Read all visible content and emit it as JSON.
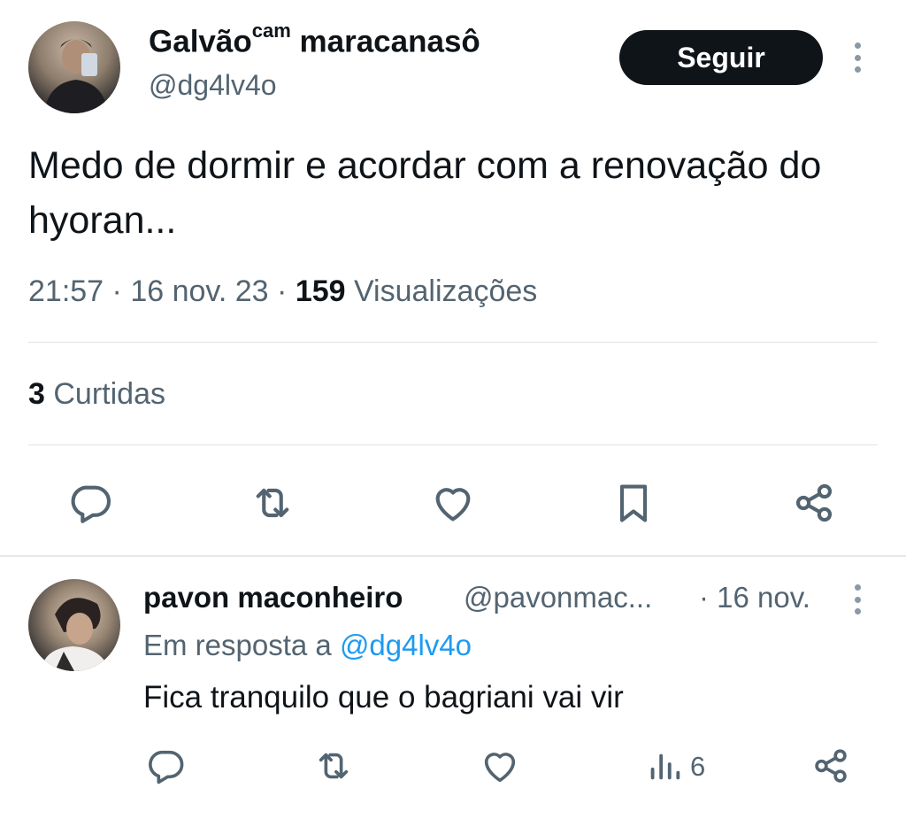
{
  "tweet": {
    "display_name": "Galvão",
    "display_name_sup": "cam",
    "display_name_rest": " maracanasô",
    "handle": "@dg4lv4o",
    "follow_label": "Seguir",
    "text": "Medo de dormir e acordar com a renovação do hyoran...",
    "time": "21:57",
    "sep1": " · ",
    "date": "16 nov. 23",
    "sep2": " · ",
    "views_count": "159",
    "views_label": " Visualizações",
    "likes_count": "3",
    "likes_label": " Curtidas"
  },
  "reply": {
    "display_name": "pavon maconheiro",
    "handle": "@pavonmac...",
    "date": "· 16 nov.",
    "replying_prefix": "Em resposta a ",
    "replying_to": "@dg4lv4o",
    "text": "Fica tranquilo que o bagriani vai vir",
    "views_count": "6"
  },
  "icons": {
    "reply": "reply-icon",
    "retweet": "retweet-icon",
    "like": "heart-icon",
    "bookmark": "bookmark-icon",
    "share": "share-icon",
    "views": "views-icon",
    "more": "more-icon"
  },
  "colors": {
    "text": "#0f1419",
    "secondary": "#536471",
    "accent": "#1d9bf0",
    "button": "#0f1419"
  }
}
